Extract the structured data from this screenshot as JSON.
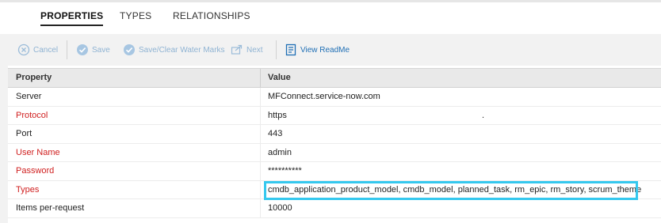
{
  "tabs": [
    {
      "label": "PROPERTIES",
      "active": true
    },
    {
      "label": "TYPES",
      "active": false
    },
    {
      "label": "RELATIONSHIPS",
      "active": false
    }
  ],
  "toolbar": {
    "cancel": "Cancel",
    "save": "Save",
    "save_clear": "Save/Clear Water Marks",
    "next": "Next",
    "view_readme": "View ReadMe"
  },
  "grid": {
    "headers": {
      "property": "Property",
      "value": "Value"
    },
    "rows": [
      {
        "property": "Server",
        "value": "MFConnect.service-now.com",
        "required": false
      },
      {
        "property": "Protocol",
        "value": "https",
        "required": true,
        "extra": "."
      },
      {
        "property": "Port",
        "value": "443",
        "required": false
      },
      {
        "property": "User Name",
        "value": "admin",
        "required": true
      },
      {
        "property": "Password",
        "value": "**********",
        "required": true
      },
      {
        "property": "Types",
        "value": "cmdb_application_product_model, cmdb_model, planned_task, rm_epic, rm_story, scrum_theme",
        "required": true,
        "highlighted": true
      },
      {
        "property": "Items per-request",
        "value": "10000",
        "required": false
      }
    ]
  },
  "colors": {
    "required_label": "#d02020",
    "highlight_border": "#35c8ee",
    "toolbar_disabled": "#8fb3d3",
    "toolbar_enabled": "#1f6fb5"
  },
  "icons": {
    "cancel": "close-circle-icon",
    "save": "check-circle-icon",
    "save_clear": "check-circle-icon",
    "next": "arrow-forward-icon",
    "view_readme": "document-icon"
  }
}
